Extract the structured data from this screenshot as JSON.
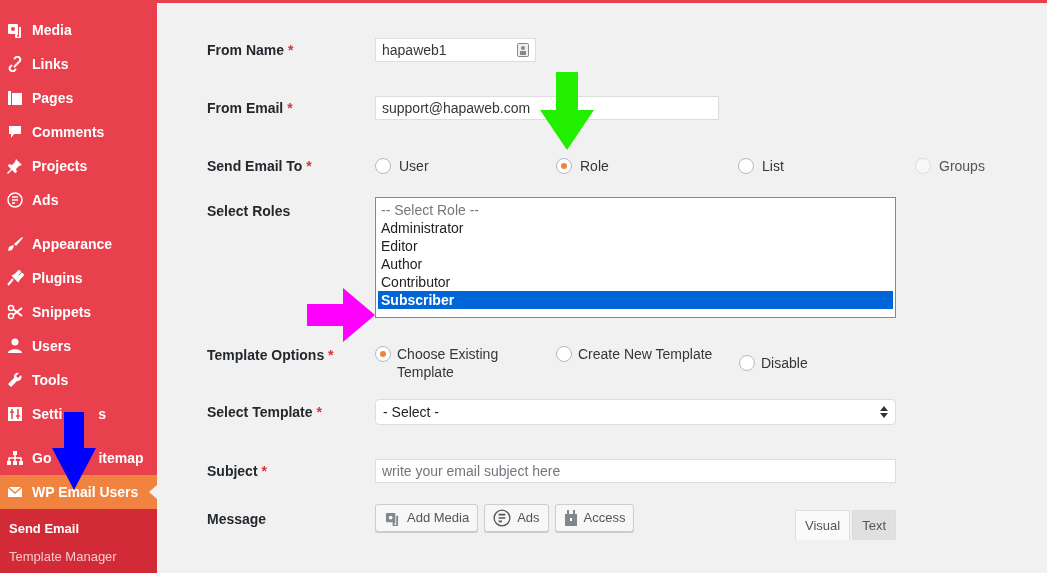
{
  "sidebar": {
    "sections": [
      {
        "items": [
          {
            "label": "Media",
            "current": false
          },
          {
            "label": "Links",
            "current": false
          },
          {
            "label": "Pages",
            "current": false
          },
          {
            "label": "Comments",
            "current": false
          },
          {
            "label": "Projects",
            "current": false
          },
          {
            "label": "Ads",
            "current": false
          }
        ]
      },
      {
        "items": [
          {
            "label": "Appearance",
            "current": false
          },
          {
            "label": "Plugins",
            "current": false
          },
          {
            "label": "Snippets",
            "current": false
          },
          {
            "label": "Users",
            "current": false
          },
          {
            "label": "Tools",
            "current": false
          },
          {
            "label": "Setti",
            "label_end": "s",
            "current": false
          }
        ]
      },
      {
        "items": [
          {
            "label": "Go",
            "label_end": "itemap",
            "current": false
          },
          {
            "label": "WP Email Users",
            "current": true
          }
        ]
      }
    ],
    "submenu": [
      {
        "label": "Send Email",
        "selected": true
      },
      {
        "label": "Template Manager",
        "selected": false
      }
    ]
  },
  "form": {
    "from_name": {
      "label": "From Name",
      "required": "*",
      "value": "hapaweb1"
    },
    "from_email": {
      "label": "From Email",
      "required": "*",
      "value": "support@hapaweb.com"
    },
    "send_email_to": {
      "label": "Send Email To",
      "required": "*",
      "options": [
        {
          "label": "User",
          "selected": false,
          "disabled": false
        },
        {
          "label": "Role",
          "selected": true,
          "disabled": false
        },
        {
          "label": "List",
          "selected": false,
          "disabled": false
        },
        {
          "label": "Groups",
          "selected": false,
          "disabled": true
        }
      ]
    },
    "select_roles": {
      "label": "Select Roles",
      "options": [
        {
          "label": "-- Select Role --",
          "selected": false,
          "kind": "placeholder"
        },
        {
          "label": "Administrator",
          "selected": false,
          "kind": "option"
        },
        {
          "label": "Editor",
          "selected": false,
          "kind": "option"
        },
        {
          "label": "Author",
          "selected": false,
          "kind": "option"
        },
        {
          "label": "Contributor",
          "selected": false,
          "kind": "option"
        },
        {
          "label": "Subscriber",
          "selected": true,
          "kind": "option"
        }
      ]
    },
    "template_options": {
      "label": "Template Options",
      "required": "*",
      "options": [
        {
          "label": "Choose Existing Template",
          "selected": true
        },
        {
          "label": "Create New Template",
          "selected": false
        },
        {
          "label": "Disable",
          "selected": false
        }
      ]
    },
    "select_template": {
      "label": "Select Template",
      "required": "*",
      "value": "- Select -"
    },
    "subject": {
      "label": "Subject",
      "required": "*",
      "placeholder": "write your email subject here"
    },
    "message": {
      "label": "Message",
      "buttons": [
        "Add Media",
        "Ads",
        "Access"
      ],
      "tabs": [
        {
          "label": "Visual",
          "selected": true
        },
        {
          "label": "Text",
          "selected": false
        }
      ]
    }
  }
}
